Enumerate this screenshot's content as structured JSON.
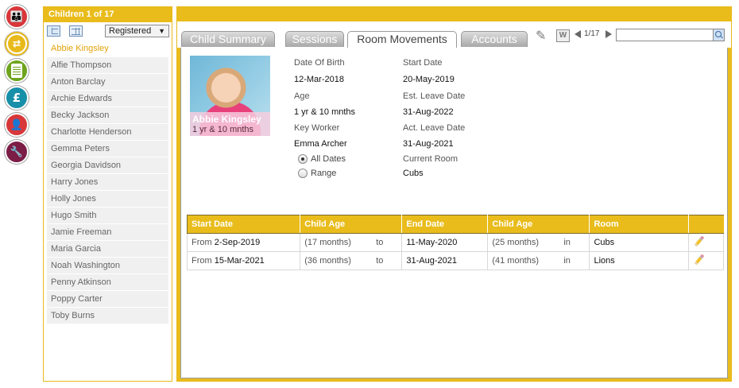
{
  "rail": [
    {
      "name": "children-group-icon",
      "glyph": "👪"
    },
    {
      "name": "room-movements-icon",
      "glyph": "⇄"
    },
    {
      "name": "reports-icon",
      "glyph": ""
    },
    {
      "name": "finance-icon",
      "glyph": "£"
    },
    {
      "name": "staff-icon",
      "glyph": "👤"
    },
    {
      "name": "settings-icon",
      "glyph": "🔧"
    }
  ],
  "children": {
    "header": "Children 1 of 17",
    "filter_value": "Registered",
    "list": [
      "Abbie Kingsley",
      "Alfie Thompson",
      "Anton Barclay",
      "Archie Edwards",
      "Becky Jackson",
      "Charlotte Henderson",
      "Gemma Peters",
      "Georgia Davidson",
      "Harry Jones",
      "Holly Jones",
      "Hugo Smith",
      "Jamie Freeman",
      "Maria Garcia",
      "Noah Washington",
      "Penny Atkinson",
      "Poppy Carter",
      "Toby Burns"
    ],
    "selected_index": 0
  },
  "tabs": {
    "items": [
      "Child Summary",
      "Sessions",
      "Room Movements",
      "Accounts"
    ],
    "active_index": 2
  },
  "toolbar": {
    "nav_count": "1/17",
    "search_value": ""
  },
  "profile": {
    "photo_name": "Abbie Kingsley",
    "photo_age": "1 yr & 10 mnths",
    "dob_label": "Date Of Birth",
    "dob_value": "12-Mar-2018",
    "age_label": "Age",
    "age_value": "1 yr & 10 mnths",
    "key_worker_label": "Key Worker",
    "key_worker_value": "Emma Archer",
    "start_date_label": "Start Date",
    "start_date_value": "20-May-2019",
    "est_leave_label": "Est. Leave Date",
    "est_leave_value": "31-Aug-2022",
    "act_leave_label": "Act. Leave Date",
    "act_leave_value": "31-Aug-2021",
    "current_room_label": "Current Room",
    "current_room_value": "Cubs",
    "radio_all": "All Dates",
    "radio_range": "Range"
  },
  "movements": {
    "headers": [
      "Start Date",
      "Child Age",
      "End Date",
      "Child Age",
      "Room"
    ],
    "rows": [
      {
        "from": "From",
        "start": "2-Sep-2019",
        "start_age": "(17 months)",
        "to": "to",
        "end": "11-May-2020",
        "end_age": "(25 months)",
        "in": "in",
        "room": "Cubs"
      },
      {
        "from": "From",
        "start": "15-Mar-2021",
        "start_age": "(36 months)",
        "to": "to",
        "end": "31-Aug-2021",
        "end_age": "(41 months)",
        "in": "in",
        "room": "Lions"
      }
    ]
  }
}
